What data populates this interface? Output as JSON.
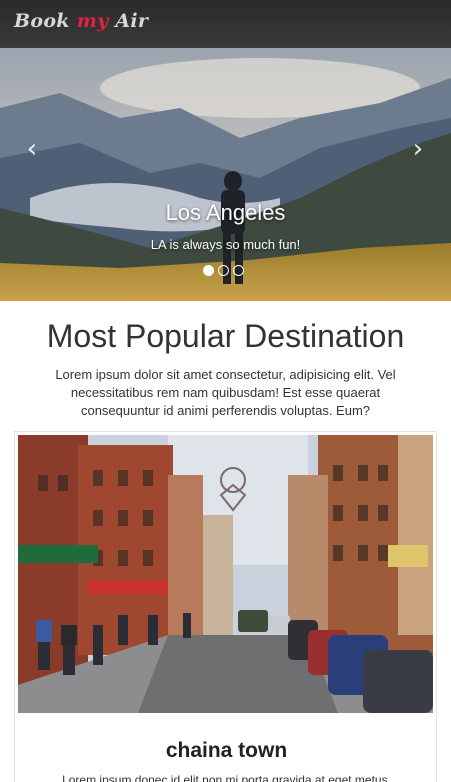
{
  "navbar": {
    "brand_part1": "Book ",
    "brand_accent": "my",
    "brand_part2": " Air",
    "accent_color": "#e0233f"
  },
  "carousel": {
    "prev_icon": "chevron-left",
    "next_icon": "chevron-right",
    "caption_title": "Los Angeles",
    "caption_text": "LA is always so much fun!",
    "slide_count": 3,
    "active_slide": 1
  },
  "section": {
    "title": "Most Popular Destination",
    "text": "Lorem ipsum dolor sit amet consectetur, adipisicing elit. Vel necessitatibus rem nam quibusdam! Est esse quaerat consequuntur id animi perferendis voluptas. Eum?"
  },
  "card": {
    "title": "chaina town",
    "text": "Lorem ipsum donec id elit non mi porta gravida at eget metus."
  }
}
